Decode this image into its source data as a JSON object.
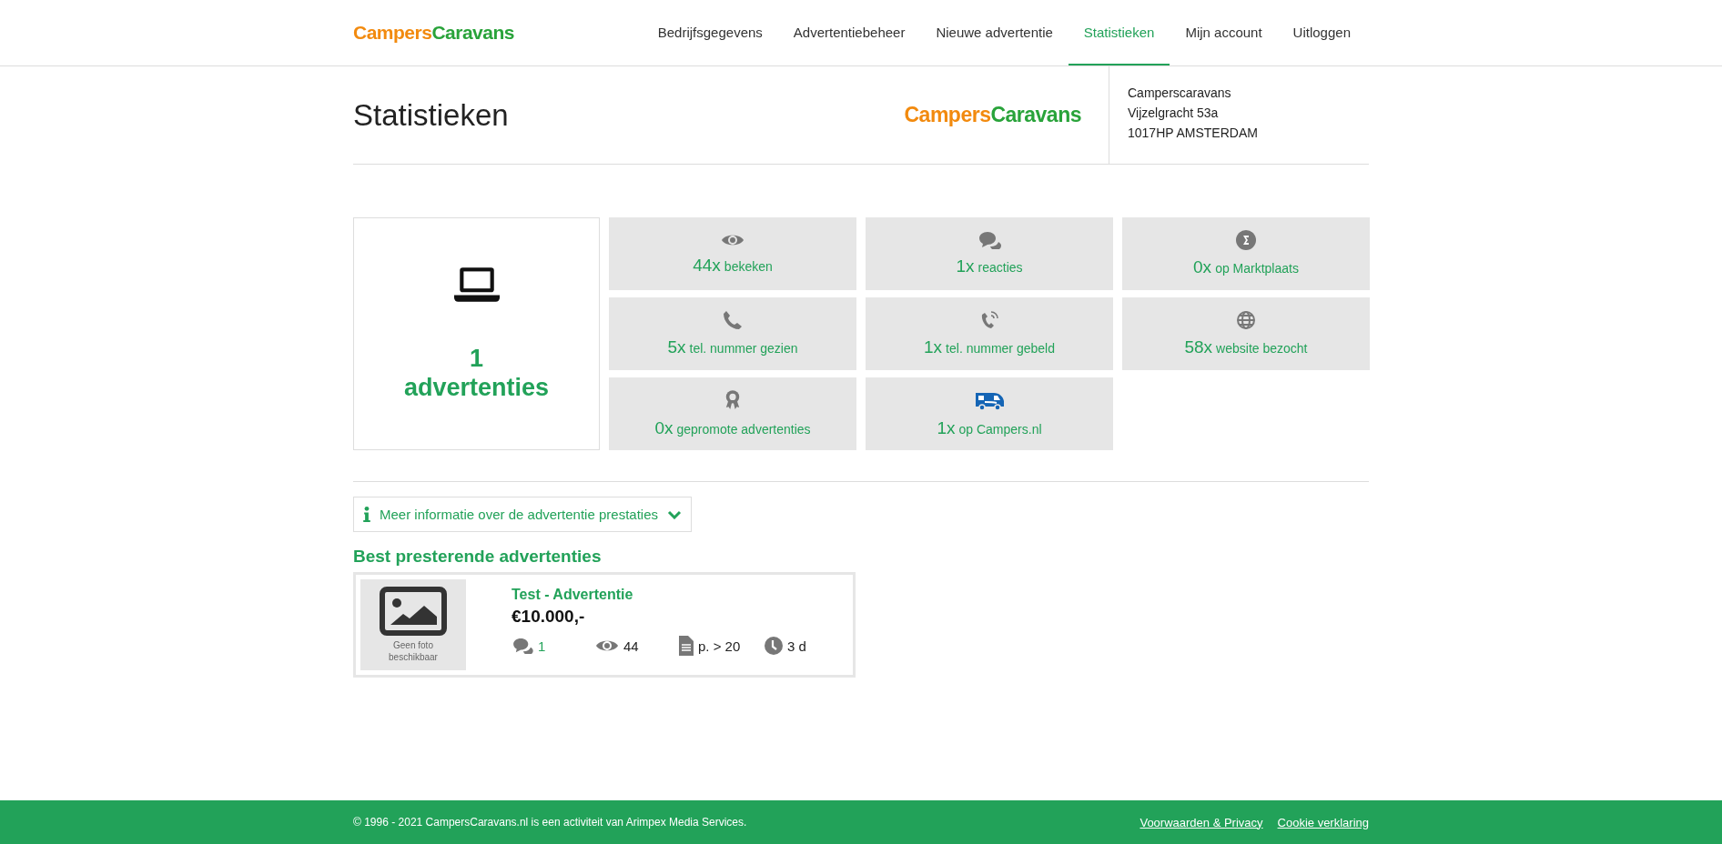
{
  "header": {
    "logo": [
      "Campers",
      "Caravans"
    ],
    "nav": [
      {
        "label": "Bedrijfsgegevens",
        "selected": false
      },
      {
        "label": "Advertentiebeheer",
        "selected": false
      },
      {
        "label": "Nieuwe advertentie",
        "selected": false
      },
      {
        "label": "Statistieken",
        "selected": true
      },
      {
        "label": "Mijn account",
        "selected": false
      },
      {
        "label": "Uitloggen",
        "selected": false
      }
    ]
  },
  "page": {
    "title": "Statistieken",
    "company_logo": [
      "Campers",
      "Caravans"
    ],
    "address": [
      "Camperscaravans",
      "Vijzelgracht 53a",
      "1017HP AMSTERDAM"
    ]
  },
  "summary": {
    "count": "1",
    "label": "advertenties"
  },
  "stats": [
    {
      "count": "44x",
      "label": "bekeken"
    },
    {
      "count": "1x",
      "label": "reacties"
    },
    {
      "count": "0x",
      "label": "op Marktplaats"
    },
    {
      "count": "5x",
      "label": "tel. nummer gezien"
    },
    {
      "count": "1x",
      "label": "tel. nummer gebeld"
    },
    {
      "count": "58x",
      "label": "website bezocht"
    },
    {
      "count": "0x",
      "label": "gepromote advertenties"
    },
    {
      "count": "1x",
      "label": "op Campers.nl"
    }
  ],
  "info_toggle": {
    "label": "Meer informatie over de advertentie prestaties",
    "expanded": false
  },
  "best_title": "Best presterende advertenties",
  "ads": [
    {
      "photo_text": "Geen foto beschikbaar",
      "title": "Test - Advertentie",
      "price": "€10.000,-",
      "metrics": [
        {
          "kind": "link",
          "value": "1"
        },
        {
          "kind": "text",
          "value": "44"
        },
        {
          "kind": "text",
          "value": "p. > 20"
        },
        {
          "kind": "text",
          "value": "3 d"
        }
      ]
    }
  ],
  "footer": {
    "copyright": "© 1996 - 2021 CampersCaravans.nl is een activiteit van Arimpex Media Services.",
    "links": [
      "Voorwaarden & Privacy",
      "Cookie verklaring"
    ]
  }
}
